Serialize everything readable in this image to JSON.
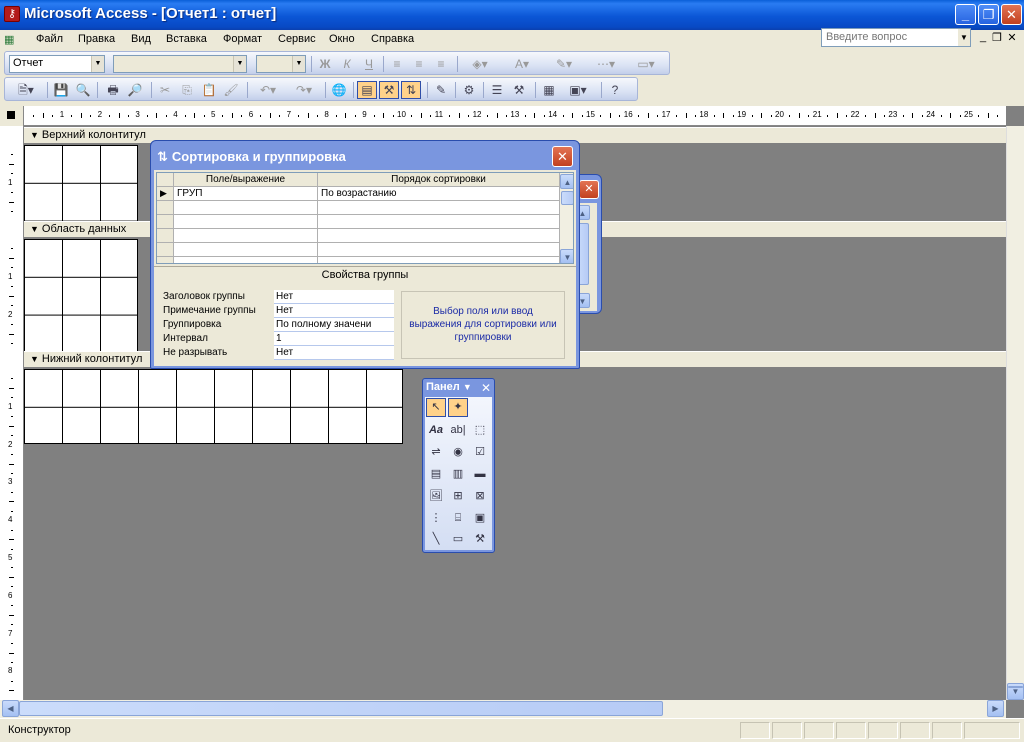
{
  "window": {
    "title": "Microsoft Access - [Отчет1 : отчет]",
    "app_icon": "access-key-icon"
  },
  "menubar": {
    "items": [
      "Файл",
      "Правка",
      "Вид",
      "Вставка",
      "Формат",
      "Сервис",
      "Окно",
      "Справка"
    ],
    "help_placeholder": "Введите вопрос"
  },
  "formatting_toolbar": {
    "object_select": "Отчет",
    "font_select": "",
    "size_select": "",
    "bold": "Ж",
    "italic": "К",
    "underline": "Ч"
  },
  "design": {
    "sections": {
      "header": "Верхний колонтитул",
      "detail": "Область данных",
      "footer": "Нижний колонтитул"
    },
    "ruler_numbers": [
      "1",
      "2",
      "3",
      "4",
      "5",
      "6",
      "7",
      "8",
      "9",
      "10",
      "11",
      "12",
      "13",
      "14",
      "15",
      "16",
      "17",
      "18",
      "19",
      "20",
      "21",
      "22",
      "23",
      "24",
      "25"
    ]
  },
  "sort_dialog": {
    "title": "Сортировка и группировка",
    "columns": [
      "Поле/выражение",
      "Порядок сортировки"
    ],
    "rows": [
      {
        "field": "ГРУП",
        "order": "По возрастанию"
      }
    ],
    "group_props_title": "Свойства группы",
    "props": [
      {
        "label": "Заголовок группы",
        "value": "Нет"
      },
      {
        "label": "Примечание группы",
        "value": "Нет"
      },
      {
        "label": "Группировка",
        "value": "По полному значени"
      },
      {
        "label": "Интервал",
        "value": "1"
      },
      {
        "label": "Не разрывать",
        "value": "Нет"
      }
    ],
    "help_text": "Выбор поля или ввод выражения для сортировки или группировки"
  },
  "toolbox": {
    "title": "Панел"
  },
  "statusbar": {
    "text": "Конструктор"
  },
  "colors": {
    "titlebar": "#0b56d6",
    "dialog_frame": "#7a96df",
    "workspace": "#808080",
    "help_text": "#1a2aa6"
  }
}
